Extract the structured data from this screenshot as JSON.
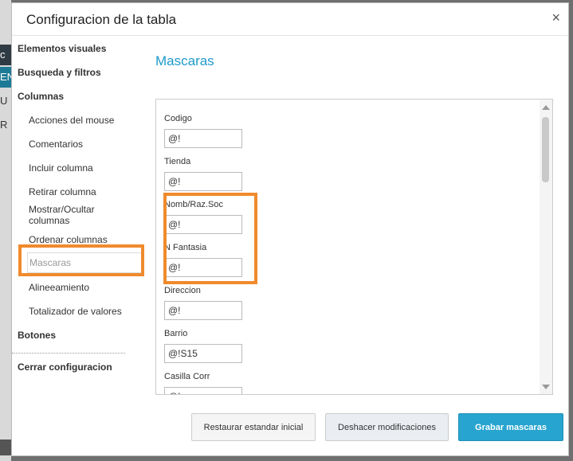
{
  "background": {
    "chips": [
      "c",
      "EN",
      "U",
      "R"
    ]
  },
  "modal": {
    "title": "Configuracion de la tabla",
    "close_glyph": "×"
  },
  "sidebar": {
    "items": [
      {
        "label": "Elementos visuales"
      },
      {
        "label": "Busqueda y filtros"
      },
      {
        "label": "Columnas"
      },
      {
        "label": "Acciones del mouse"
      },
      {
        "label": "Comentarios"
      },
      {
        "label": "Incluir columna"
      },
      {
        "label": "Retirar columna"
      },
      {
        "label": "Mostrar/Ocultar columnas"
      },
      {
        "label": "Ordenar columnas"
      },
      {
        "label": "Mascaras"
      },
      {
        "label": "Alineeamiento"
      },
      {
        "label": "Totalizador de valores"
      },
      {
        "label": "Botones"
      },
      {
        "label": "Cerrar configuracion"
      }
    ],
    "active": "Mascaras"
  },
  "main": {
    "title": "Mascaras",
    "fields": [
      {
        "label": "Codigo",
        "value": "@!"
      },
      {
        "label": "Tienda",
        "value": "@!"
      },
      {
        "label": "Nomb/Raz.Soc",
        "value": "@!"
      },
      {
        "label": "N Fantasia",
        "value": "@!"
      },
      {
        "label": "Direccion",
        "value": "@!"
      },
      {
        "label": "Barrio",
        "value": "@!S15"
      },
      {
        "label": "Casilla Corr",
        "value": "@!"
      }
    ]
  },
  "buttons": {
    "restore": "Restaurar estandar inicial",
    "undo": "Deshacer modificaciones",
    "save": "Grabar mascaras"
  },
  "colors": {
    "accent": "#27a4cf",
    "highlight": "#f08a2c",
    "title": "#1e9ac9"
  }
}
